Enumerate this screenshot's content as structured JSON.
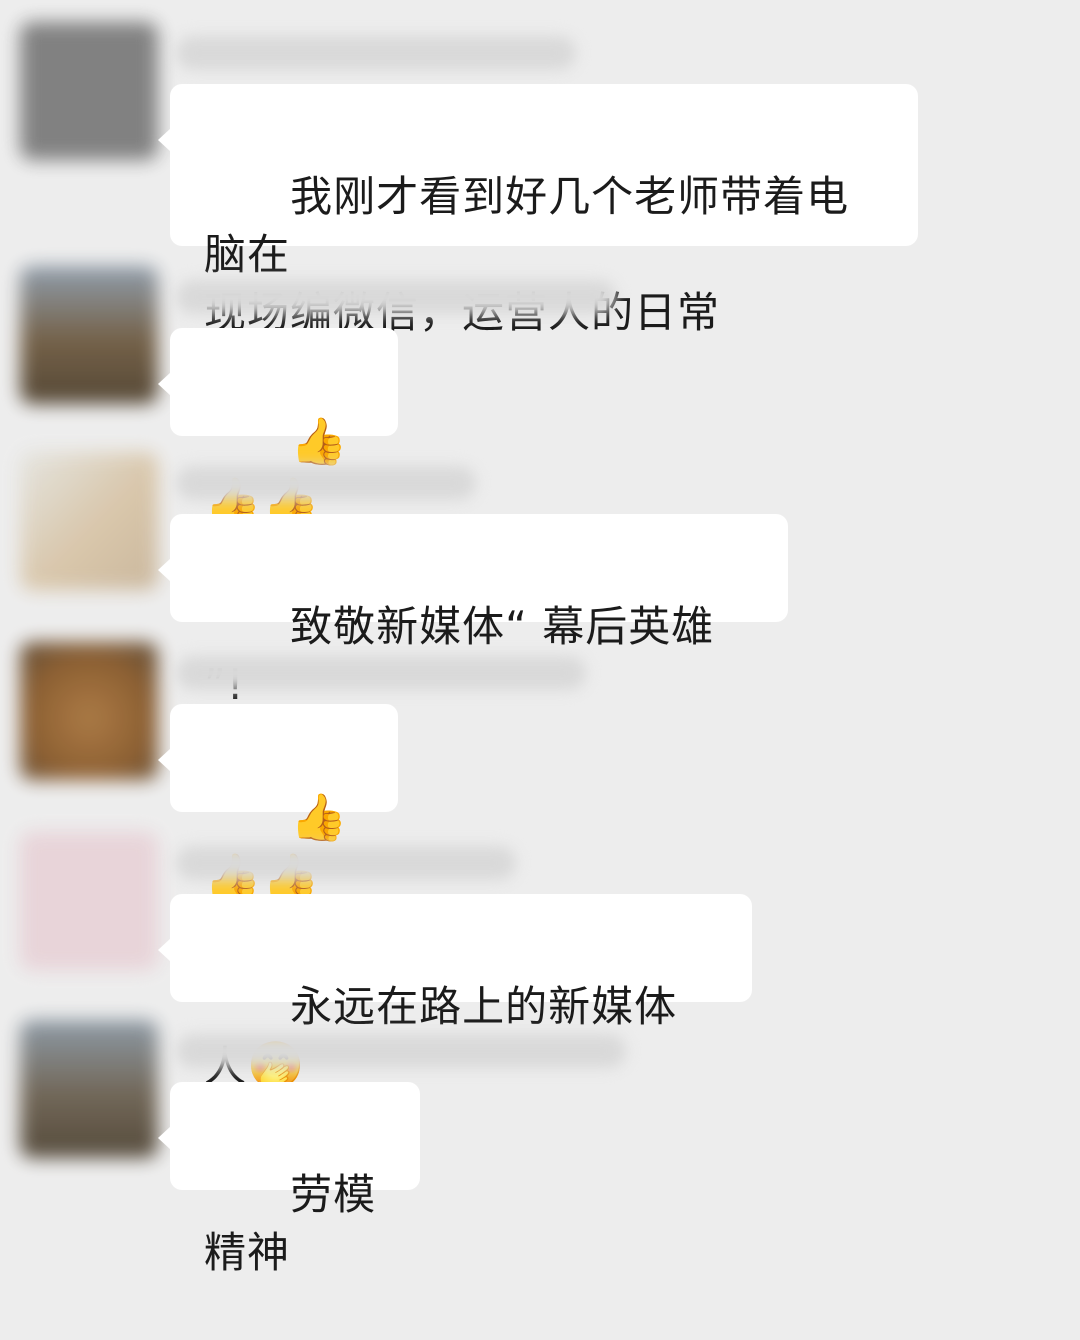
{
  "messages": [
    {
      "text": "我刚才看到好几个老师带着电脑在\n现场编微信，运营人的日常",
      "avatar_color": "#7c7c7c"
    },
    {
      "emoji": "👍👍👍",
      "avatar_color": "#6e5a40"
    },
    {
      "text": "致敬新媒体“ 幕后英雄 ”!",
      "avatar_color": "#c9b59a"
    },
    {
      "emoji": "👍👍👍",
      "avatar_color": "#9a6a35"
    },
    {
      "text": "永远在路上的新媒体人",
      "emoji": "🤭",
      "avatar_color": "#e8d3d8"
    },
    {
      "text": "劳模精神",
      "avatar_color": "#6b6050"
    }
  ],
  "colors": {
    "background": "#ededed",
    "bubble": "#ffffff",
    "text": "#1b1b1b"
  }
}
